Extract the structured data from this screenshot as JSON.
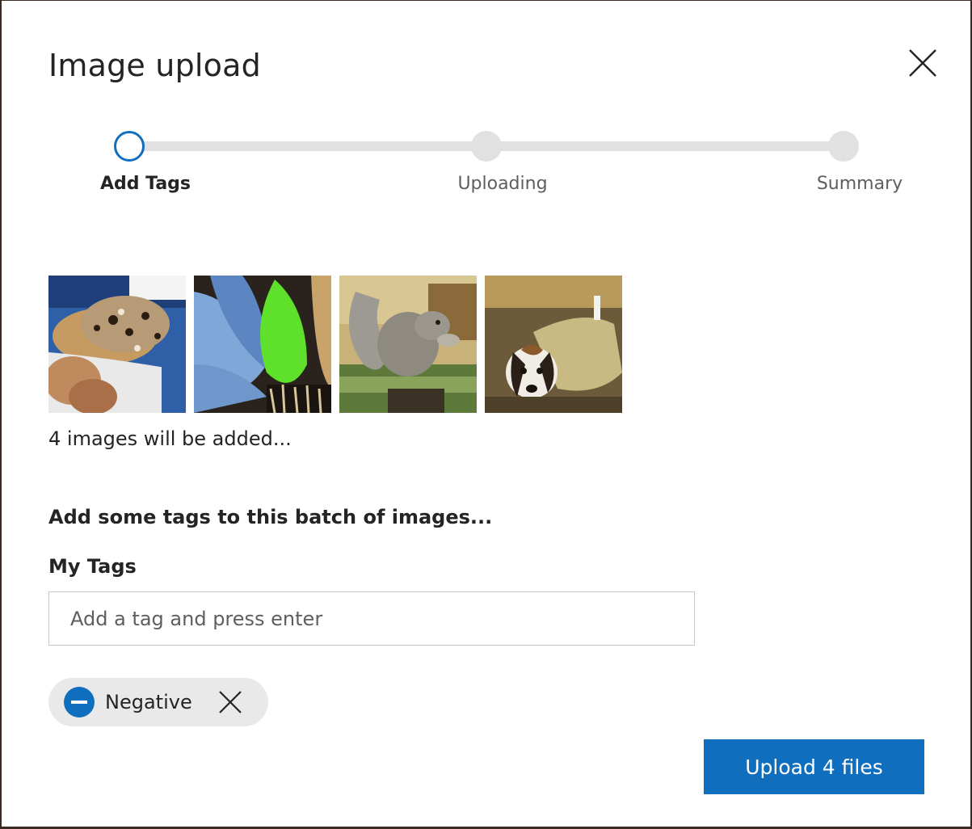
{
  "dialog": {
    "title": "Image upload",
    "close_icon": "close-icon"
  },
  "stepper": {
    "steps": [
      {
        "label": "Add Tags",
        "state": "active"
      },
      {
        "label": "Uploading",
        "state": "pending"
      },
      {
        "label": "Summary",
        "state": "pending"
      }
    ]
  },
  "thumbnails": [
    {
      "name": "thumbnail-ice-cream-taco"
    },
    {
      "name": "thumbnail-flower-petals"
    },
    {
      "name": "thumbnail-squirrel"
    },
    {
      "name": "thumbnail-beagle"
    }
  ],
  "images_count_text": "4 images will be added...",
  "tags_section": {
    "heading": "Add some tags to this batch of images...",
    "label": "My Tags",
    "input_placeholder": "Add a tag and press enter",
    "input_value": ""
  },
  "tags": [
    {
      "label": "Negative",
      "icon": "minus-circle-icon",
      "remove_icon": "close-icon"
    }
  ],
  "upload_button": {
    "label": "Upload 4 files"
  },
  "colors": {
    "accent": "#106ebe",
    "track": "#e1e1e1",
    "chip_bg": "#e9e9e9",
    "border": "#3b2a22"
  }
}
